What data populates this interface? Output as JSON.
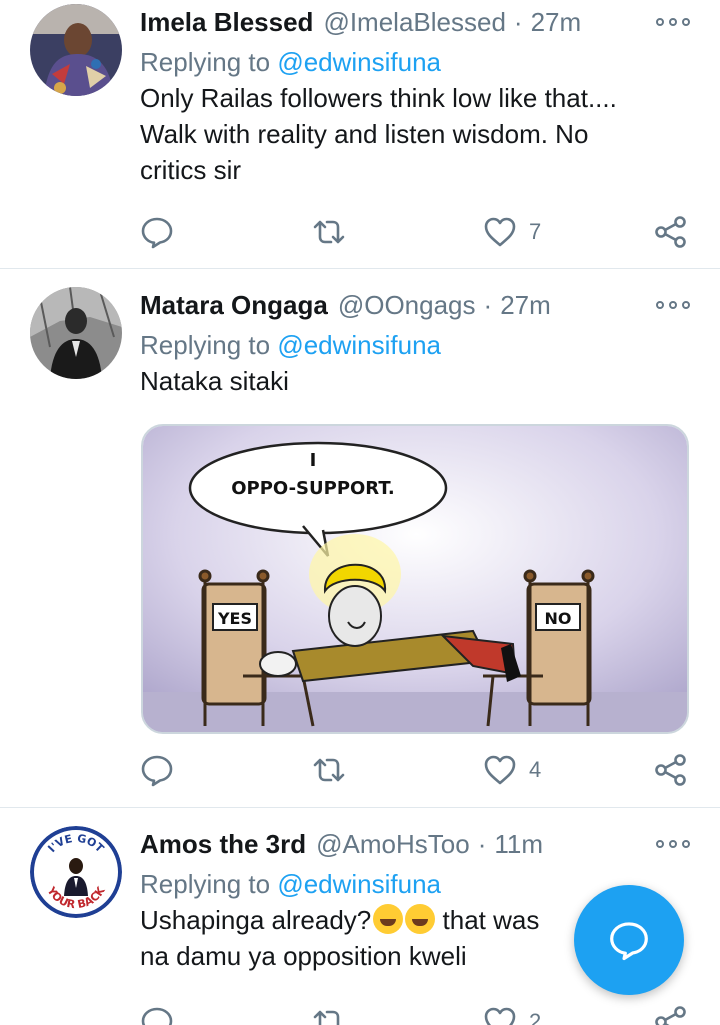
{
  "tweets": [
    {
      "display_name": "Imela Blessed",
      "handle": "@ImelaBlessed",
      "time": "27m",
      "replying_prefix": "Replying to",
      "replying_to": "@edwinsifuna",
      "text_lines": [
        "Only Railas followers think low like that....",
        "Walk with reality and listen wisdom. No",
        "critics sir"
      ],
      "likes": "7",
      "replies": "",
      "retweets": ""
    },
    {
      "display_name": "Matara Ongaga",
      "handle": "@OOngags",
      "time": "27m",
      "replying_prefix": "Replying to",
      "replying_to": "@edwinsifuna",
      "text_lines": [
        "Nataka sitaki"
      ],
      "likes": "4",
      "media": {
        "speech_line1": "I",
        "speech_line2": "OPPO-SUPPORT.",
        "left_chair_sign": "YES",
        "right_chair_sign": "NO"
      }
    },
    {
      "display_name": "Amos the 3rd",
      "handle": "@AmoHsToo",
      "time": "11m",
      "replying_prefix": "Replying to",
      "replying_to": "@edwinsifuna",
      "text_line1_a": "Ushapinga already?",
      "text_line1_b": " that was",
      "text_line2": "na damu ya opposition kweli",
      "likes": "2",
      "avatar_text_top": "I'VE GOT",
      "avatar_text_bottom": "YOUR BACK"
    }
  ],
  "colors": {
    "accent": "#1da1f2",
    "muted": "#657786",
    "divider": "#e1e8ed"
  },
  "icons": [
    "reply-icon",
    "retweet-icon",
    "like-icon",
    "share-icon",
    "more-icon",
    "compose-reply-icon"
  ]
}
